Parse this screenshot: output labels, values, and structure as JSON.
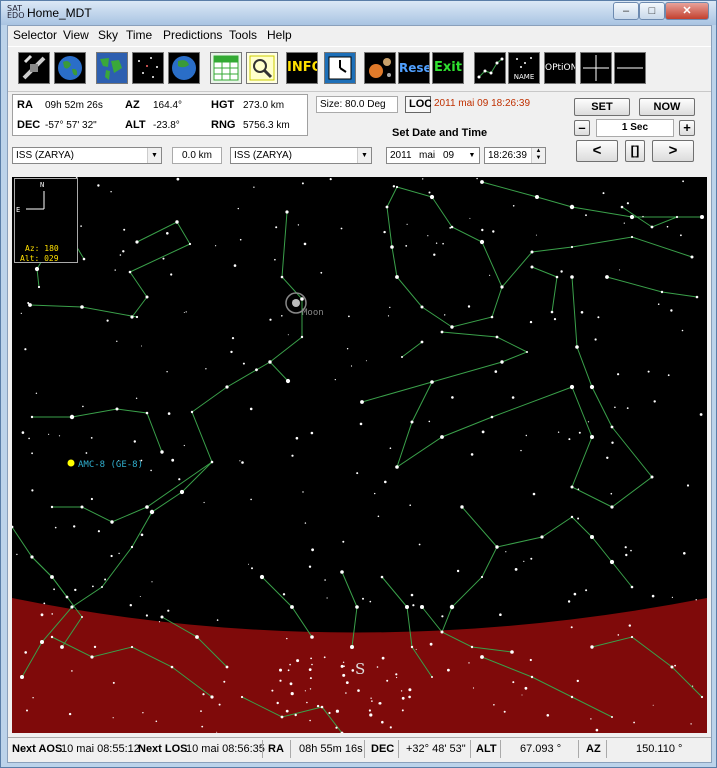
{
  "window": {
    "title": "Home_MDT",
    "app_icon_text": "SAT EDO",
    "minimize": "–",
    "maximize": "□",
    "close": "✕"
  },
  "menu": [
    "Selector",
    "View",
    "Sky",
    "Time",
    "Predictions",
    "Tools",
    "Help"
  ],
  "toolbar": {
    "info_label": "INFO",
    "reset_label": "Reset",
    "exit_label": "Exit",
    "name_label": "NAME",
    "option_label": "OPtiON",
    "icons": [
      "satellite-icon",
      "earth-globe-icon",
      "world-map-icon",
      "star-field-icon",
      "earth-view-icon",
      "spreadsheet-icon",
      "magnifier-icon",
      "info-icon",
      "clock-icon",
      "solar-system-icon",
      "reset-icon",
      "exit-icon",
      "constellation-icon",
      "name-icon",
      "option-icon",
      "crosshair-icon",
      "horizon-line-icon"
    ]
  },
  "coords": {
    "ra_label": "RA",
    "ra_value": "09h 52m 26s",
    "az_label": "AZ",
    "az_value": "164.4°",
    "hgt_label": "HGT",
    "hgt_value": "273.0 km",
    "dec_label": "DEC",
    "dec_value": "-57° 57' 32\"",
    "alt_label": "ALT",
    "alt_value": "-23.8°",
    "rng_label": "RNG",
    "rng_value": "5756.3 km"
  },
  "size_text": "Size: 80.0 Deg",
  "loc": {
    "label": "LOC",
    "value": "2011 mai 09   18:26:39"
  },
  "set_date_label": "Set  Date and Time",
  "selectors": {
    "sat1": "ISS (ZARYA)",
    "distance": "0.0 km",
    "sat2": "ISS (ZARYA)"
  },
  "date": {
    "year": "2011",
    "month": "mai",
    "day": "09",
    "time": "18:26:39"
  },
  "controls": {
    "set": "SET",
    "now": "NOW",
    "minus": "–",
    "step": "1 Sec",
    "plus": "+",
    "back": "<",
    "pause": "[]",
    "fwd": ">"
  },
  "sky": {
    "compass_north": "N",
    "compass_east": "E",
    "az_readout": "Az: 180",
    "alt_readout": "Alt: 029",
    "moon_label": "Moon",
    "satellite_label": "AMC-8 (GE-8)",
    "south_label": "S",
    "colors": {
      "sky": "#000000",
      "horizon": "#7f0a0a",
      "lines": "#3aa04a",
      "stars": "#ffffff",
      "satellite": "#ffff00",
      "sat_label": "#30b0d0"
    }
  },
  "status": {
    "aos_label": "Next AOS",
    "aos_value": "10 mai 08:55:12",
    "los_label": "Next LOS",
    "los_value": "10 mai 08:56:35",
    "ra_label": "RA",
    "ra_value": "08h 55m 16s",
    "dec_label": "DEC",
    "dec_value": "+32° 48' 53\"",
    "alt_label": "ALT",
    "alt_value": "67.093 °",
    "az_label": "AZ",
    "az_value": "150.110 °"
  }
}
